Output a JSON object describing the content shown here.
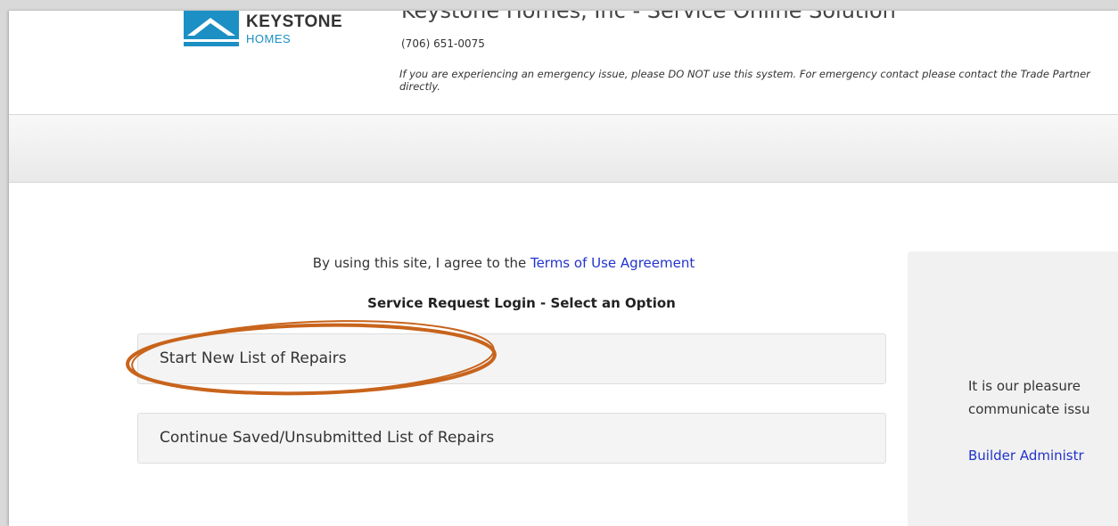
{
  "header": {
    "logo_word": "KEYSTONE",
    "logo_sub": "HOMES",
    "site_title": "Keystone Homes, Inc - Service Online Solution",
    "phone": "(706) 651-0075",
    "warning": "If you are experiencing an emergency issue, please DO NOT use this system. For emergency contact please contact the Trade Partner directly."
  },
  "main": {
    "agree_prefix": "By using this site, I agree to the ",
    "terms_link": "Terms of Use Agreement",
    "login_title": "Service Request Login - Select an Option",
    "options": [
      {
        "label": "Start New List of Repairs"
      },
      {
        "label": "Continue Saved/Unsubmitted List of Repairs"
      }
    ]
  },
  "side_panel": {
    "text_line1": "It is our pleasure",
    "text_line2": "communicate issu",
    "link": "Builder Administr"
  },
  "colors": {
    "brand_blue": "#1c8fc4",
    "link_blue": "#2233cc",
    "highlight_orange": "#c8641c"
  }
}
